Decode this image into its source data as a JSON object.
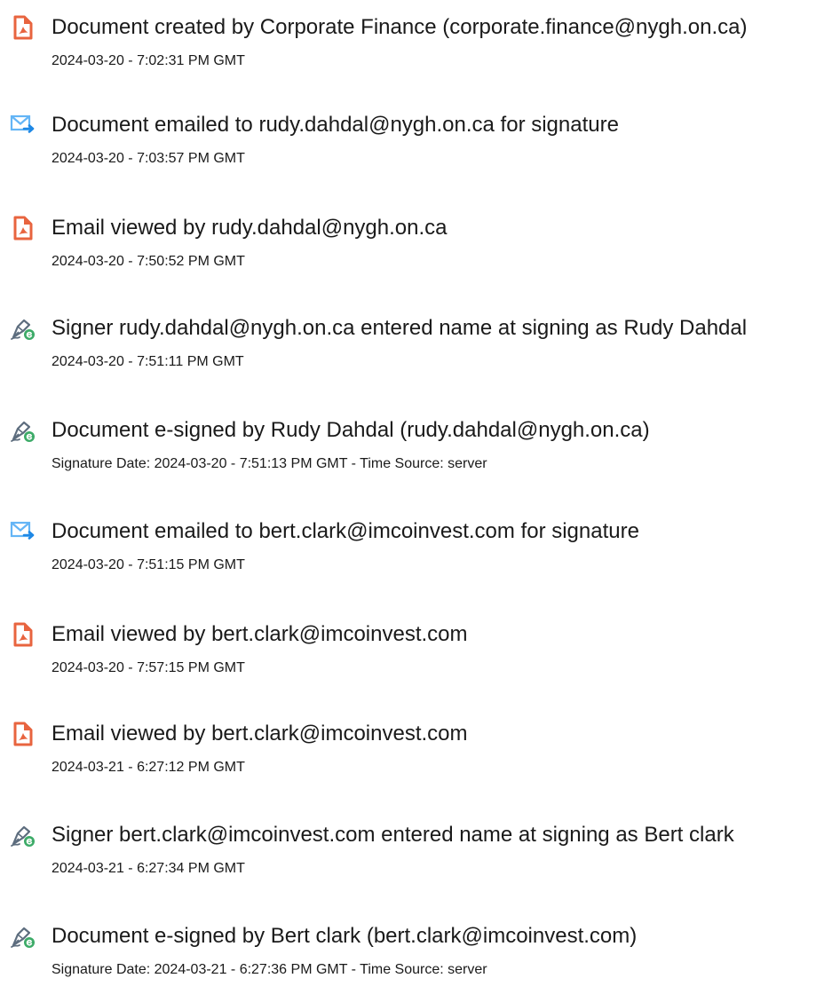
{
  "colors": {
    "document_icon": "#e8643f",
    "email_icon": "#1e88e5",
    "signature_icon": "#3dab68",
    "text": "#1a1a1a"
  },
  "events": [
    {
      "icon": "document-icon",
      "title": "Document created by Corporate Finance (corporate.finance@nygh.on.ca)",
      "time": "2024-03-20 - 7:02:31 PM GMT"
    },
    {
      "icon": "email-sent-icon",
      "title": "Document emailed to rudy.dahdal@nygh.on.ca for signature",
      "time": "2024-03-20 - 7:03:57 PM GMT"
    },
    {
      "icon": "document-icon",
      "title": "Email viewed by rudy.dahdal@nygh.on.ca",
      "time": "2024-03-20 - 7:50:52 PM GMT"
    },
    {
      "icon": "signature-icon",
      "title": "Signer rudy.dahdal@nygh.on.ca entered name at signing as Rudy Dahdal",
      "time": "2024-03-20 - 7:51:11 PM GMT"
    },
    {
      "icon": "signature-icon",
      "title": "Document e-signed by Rudy Dahdal (rudy.dahdal@nygh.on.ca)",
      "time": "Signature Date: 2024-03-20 - 7:51:13 PM GMT - Time Source: server"
    },
    {
      "icon": "email-sent-icon",
      "title": "Document emailed to bert.clark@imcoinvest.com for signature",
      "time": "2024-03-20 - 7:51:15 PM GMT"
    },
    {
      "icon": "document-icon",
      "title": "Email viewed by bert.clark@imcoinvest.com",
      "time": "2024-03-20 - 7:57:15 PM GMT"
    },
    {
      "icon": "document-icon",
      "title": "Email viewed by bert.clark@imcoinvest.com",
      "time": "2024-03-21 - 6:27:12 PM GMT"
    },
    {
      "icon": "signature-icon",
      "title": "Signer bert.clark@imcoinvest.com entered name at signing as Bert clark",
      "time": "2024-03-21 - 6:27:34 PM GMT"
    },
    {
      "icon": "signature-icon",
      "title": "Document e-signed by Bert clark (bert.clark@imcoinvest.com)",
      "time": "Signature Date: 2024-03-21 - 6:27:36 PM GMT - Time Source: server"
    }
  ]
}
